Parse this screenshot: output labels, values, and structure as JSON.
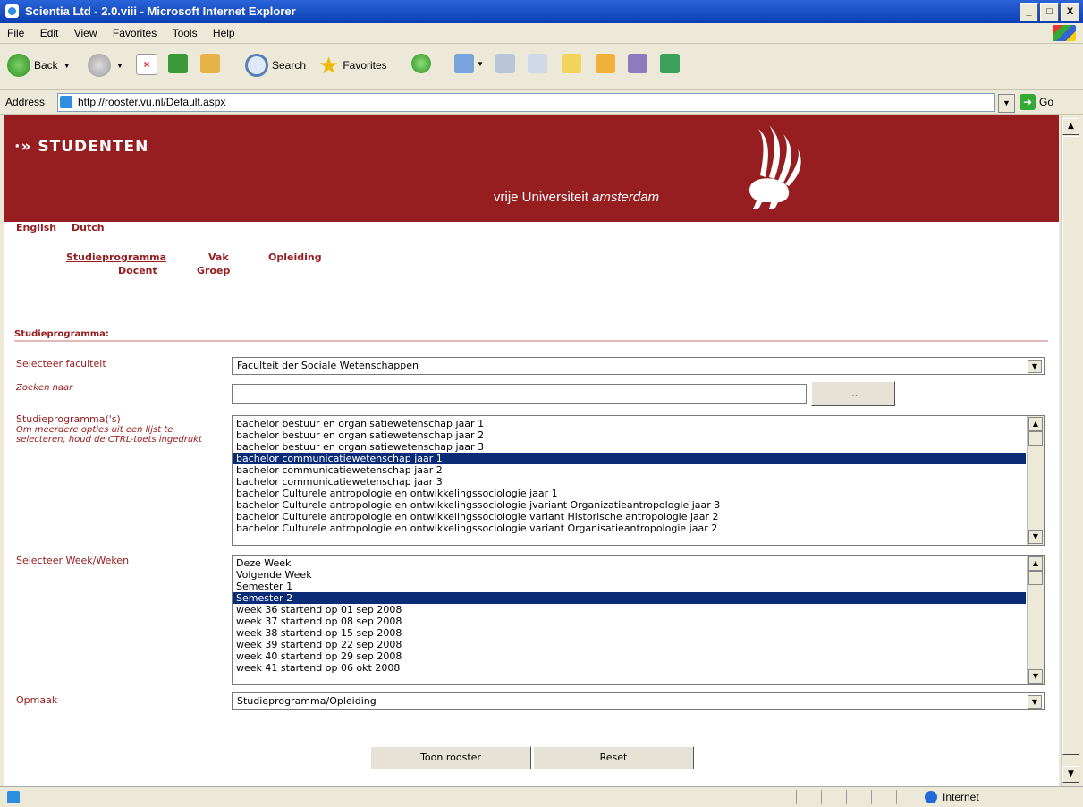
{
  "window": {
    "title": "Scientia Ltd - 2.0.viii - Microsoft Internet Explorer",
    "controls": [
      "_",
      "□",
      "X"
    ]
  },
  "menu": [
    "File",
    "Edit",
    "View",
    "Favorites",
    "Tools",
    "Help"
  ],
  "toolbar": {
    "back_label": "Back",
    "search_label": "Search",
    "favorites_label": "Favorites"
  },
  "address": {
    "label": "Address",
    "url": "http://rooster.vu.nl/Default.aspx",
    "go_label": "Go"
  },
  "banner": {
    "brand": "·» STUDENTEN",
    "uni_prefix": "vrije Universiteit",
    "uni_suffix": "amsterdam",
    "brand_color": "#961e20"
  },
  "lang": {
    "english": "English",
    "dutch": "Dutch"
  },
  "nav": {
    "studieprogramma": "Studieprogramma",
    "vak": "Vak",
    "opleiding": "Opleiding",
    "docent": "Docent",
    "groep": "Groep"
  },
  "form": {
    "section_title": "Studieprogramma:",
    "faculteit_label": "Selecteer faculteit",
    "faculteit_value": "Faculteit der Sociale Wetenschappen",
    "zoeken_label": "Zoeken naar",
    "zoeken_value": "",
    "zoeken_button": "...",
    "programma_label": "Studieprogramma('s)",
    "programma_hint": "Om meerdere opties uit een lijst te selecteren, houd de CTRL-toets ingedrukt",
    "programma_items": [
      "bachelor bestuur en organisatiewetenschap jaar 1",
      "bachelor bestuur en organisatiewetenschap jaar 2",
      "bachelor bestuur en organisatiewetenschap jaar 3",
      "bachelor communicatiewetenschap jaar 1",
      "bachelor communicatiewetenschap jaar 2",
      "bachelor communicatiewetenschap jaar 3",
      "bachelor Culturele antropologie en ontwikkelingssociologie jaar 1",
      "bachelor Culturele antropologie en ontwikkelingssociologie jvariant Organizatieantropologie jaar 3",
      "bachelor Culturele antropologie en ontwikkelingssociologie variant Historische antropologie jaar 2",
      "bachelor Culturele antropologie en ontwikkelingssociologie variant Organisatieantropologie jaar 2"
    ],
    "programma_selected": 3,
    "week_label": "Selecteer Week/Weken",
    "week_items": [
      "Deze Week",
      "Volgende Week",
      "Semester 1",
      "Semester 2",
      "week 36 startend op 01 sep 2008",
      "week 37 startend op 08 sep 2008",
      "week 38 startend op 15 sep 2008",
      "week 39 startend op 22 sep 2008",
      "week 40 startend op 29 sep 2008",
      "week 41 startend op 06 okt 2008"
    ],
    "week_selected": 3,
    "opmaak_label": "Opmaak",
    "opmaak_value": "Studieprogramma/Opleiding",
    "toon_button": "Toon rooster",
    "reset_button": "Reset"
  },
  "status": {
    "zone": "Internet"
  }
}
